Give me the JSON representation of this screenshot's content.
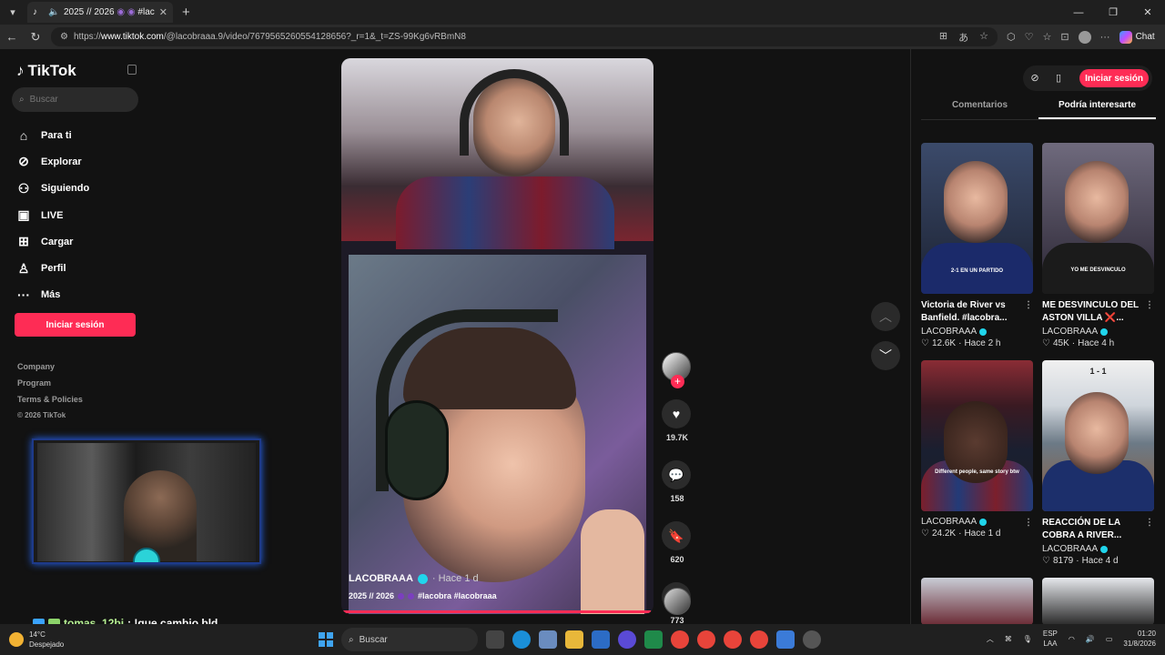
{
  "browser": {
    "tab_title": "2025 // 2026",
    "tab_tag": "#lacobra",
    "url_prefix": "https://",
    "url_host": "www.tiktok.com",
    "url_path": "/@lacobraaa.9/video/7679565260554128656?_r=1&_t=ZS-99Kg6vRBmN8",
    "chat_label": "Chat"
  },
  "sidebar": {
    "logo": "TikTok",
    "search_placeholder": "Buscar",
    "nav": [
      {
        "label": "Para ti",
        "icon": "home-icon"
      },
      {
        "label": "Explorar",
        "icon": "compass-icon"
      },
      {
        "label": "Siguiendo",
        "icon": "following-icon"
      },
      {
        "label": "LIVE",
        "icon": "live-icon"
      },
      {
        "label": "Cargar",
        "icon": "upload-icon"
      },
      {
        "label": "Perfil",
        "icon": "profile-icon"
      },
      {
        "label": "Más",
        "icon": "more-icon"
      }
    ],
    "login_label": "Iniciar sesión",
    "footer": [
      "Company",
      "Program",
      "Terms & Policies"
    ],
    "copyright": "© 2026 TikTok"
  },
  "chat_overlay": {
    "user": "tomas_12bj",
    "message": ": !que cambio bld"
  },
  "video": {
    "author": "LACOBRAAA",
    "time": "· Hace 1 d",
    "caption_title": "2025 // 2026",
    "caption_tags": "#lacobra #lacobraaa",
    "progress": 0.99,
    "likes": "19.7K",
    "comments": "158",
    "saves": "620",
    "shares": "773"
  },
  "right_panel": {
    "login_label": "Iniciar sesión",
    "tabs": [
      "Comentarios",
      "Podría interesarte"
    ],
    "active_tab": 1,
    "cards": [
      {
        "title": "Victoria de River vs Banfield. #lacobra...",
        "author": "LACOBRAAA",
        "likes": "12.6K",
        "time": "Hace 2 h",
        "overlay": "2-1 EN UN PARTIDO"
      },
      {
        "title": "ME DESVINCULO DEL ASTON VILLA ❌...",
        "author": "LACOBRAAA",
        "likes": "45K",
        "time": "Hace 4 h",
        "overlay": "YO ME DESVINCULO"
      },
      {
        "title": "",
        "author": "LACOBRAAA",
        "likes": "24.2K",
        "time": "Hace 1 d",
        "overlay": "Different people, same story btw"
      },
      {
        "title": "REACCIÓN DE LA COBRA A RIVER...",
        "author": "LACOBRAAA",
        "likes": "8179",
        "time": "Hace 4 d",
        "overlay": "1 - 1"
      }
    ]
  },
  "taskbar": {
    "temp": "14°C",
    "weather": "Despejado",
    "search": "Buscar",
    "lang1": "ESP",
    "lang2": "LAA",
    "time": "01:20",
    "date": "31/8/2026"
  }
}
